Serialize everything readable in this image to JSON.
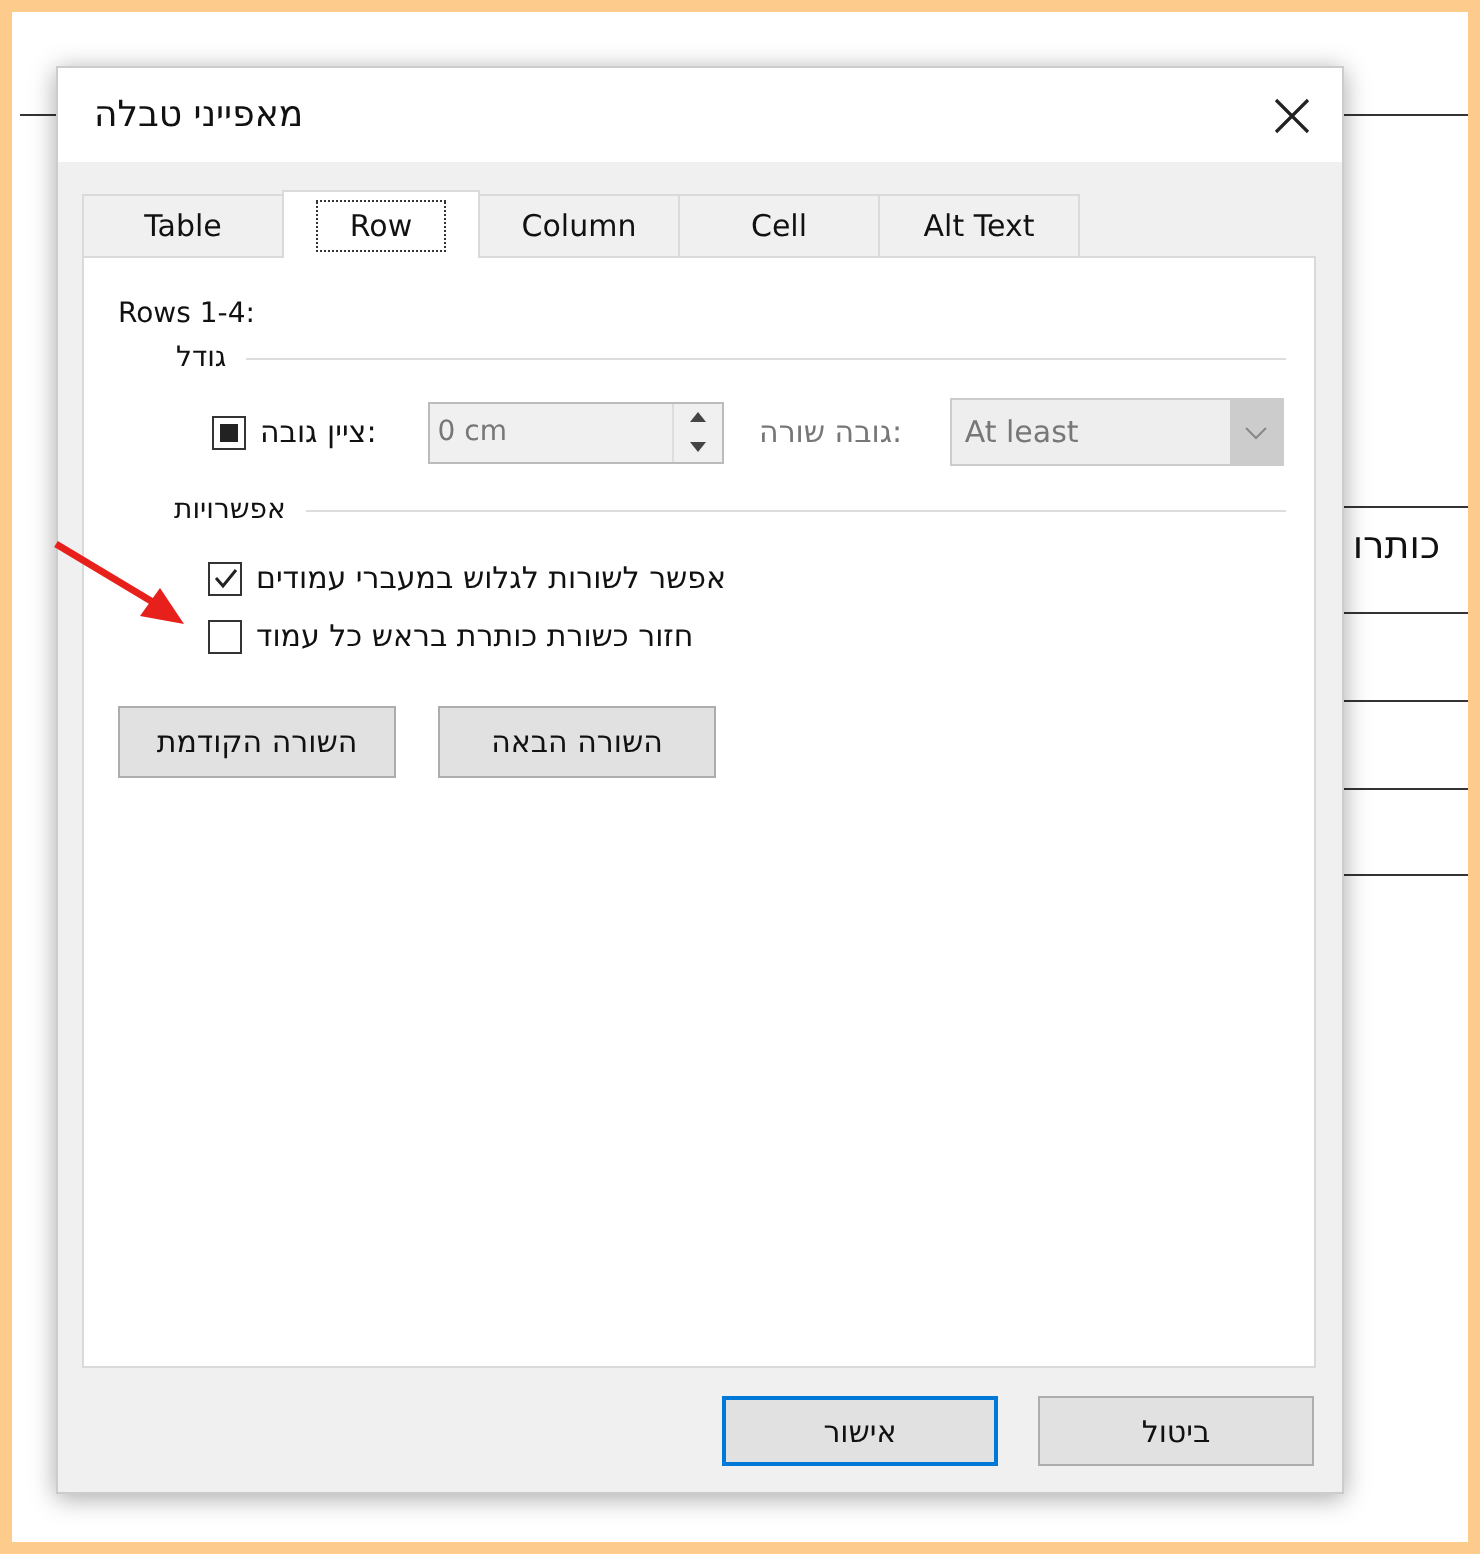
{
  "document": {
    "heading_cell": "כותרו"
  },
  "window": {
    "title": "מאפייני טבלה"
  },
  "tabs": [
    {
      "label": "Alt Text",
      "selected": false
    },
    {
      "label": "Cell",
      "selected": false
    },
    {
      "label": "Column",
      "selected": false
    },
    {
      "label": "Row",
      "selected": true
    },
    {
      "label": "Table",
      "selected": false
    }
  ],
  "rows_label": "Rows 1-4:",
  "size_group": {
    "title": "גודל",
    "specify_height": {
      "label": "ציין גובה:",
      "mixed": true
    },
    "height_field": {
      "value": "0 cm",
      "disabled": true
    },
    "row_height_label": {
      "label": "גובה שורה:",
      "disabled": true
    },
    "row_height_select": {
      "value": "At least",
      "disabled": true
    }
  },
  "options_group": {
    "title": "אפשרויות",
    "options": [
      {
        "label": "אפשר לשורות לגלוש במעברי עמודים",
        "checked": true
      },
      {
        "label": "חזור כשורת כותרת בראש כל עמוד",
        "checked": false
      }
    ]
  },
  "nav_buttons": [
    "השורה הבאה",
    "השורה הקודמת"
  ],
  "buttons": [
    {
      "label": "ביטול",
      "default": false
    },
    {
      "label": "אישור",
      "default": true
    }
  ]
}
